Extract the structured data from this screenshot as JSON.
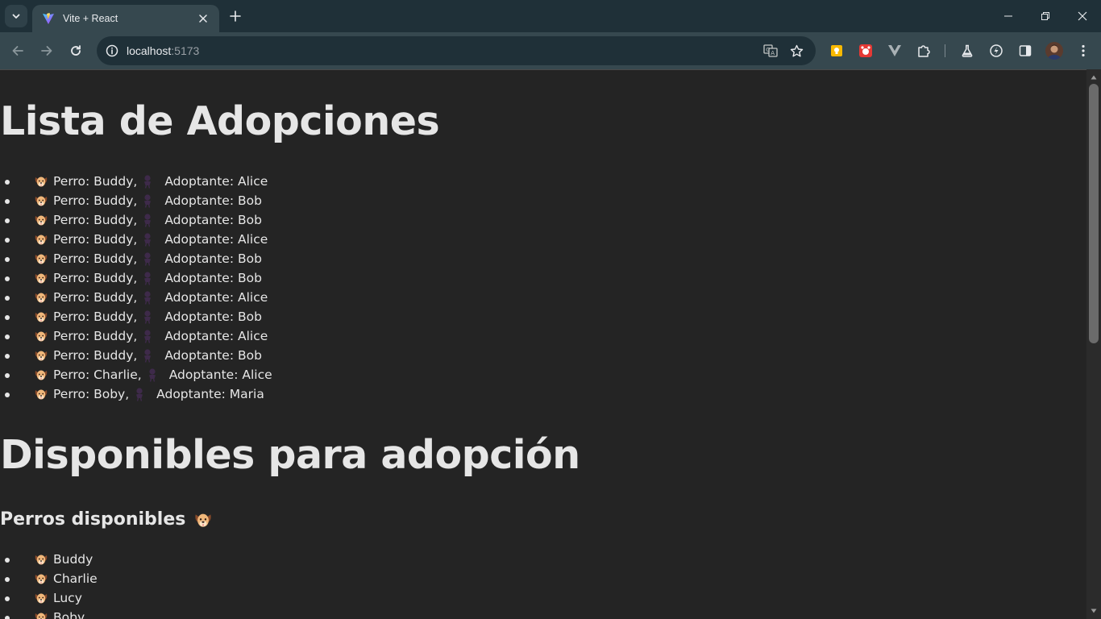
{
  "browser": {
    "tab_title": "Vite + React",
    "url_host": "localhost",
    "url_port": ":5173",
    "icons": {
      "tab_search": "chevron-down-icon",
      "favicon": "vite-logo-icon",
      "tab_close": "close-icon",
      "new_tab": "plus-icon",
      "back": "arrow-left-icon",
      "forward": "arrow-right-icon",
      "reload": "reload-icon",
      "site_info": "info-icon",
      "translate": "translate-icon",
      "bookmark": "star-icon",
      "extensions": "puzzle-icon",
      "labs": "flask-icon",
      "performance": "speedometer-icon",
      "side_panel": "side-panel-icon",
      "menu": "kebab-menu-icon",
      "minimize": "minimize-icon",
      "restore": "restore-icon",
      "close_window": "close-icon"
    },
    "accent_colors": {
      "tabstrip": "#1f3038",
      "toolbar": "#36484f",
      "page_background": "#242424"
    }
  },
  "page": {
    "adoptions_title": "Lista de Adopciones",
    "adoptions": [
      {
        "dog": "Perro: Buddy,",
        "adopter": "Adoptante: Alice"
      },
      {
        "dog": "Perro: Buddy,",
        "adopter": "Adoptante: Bob"
      },
      {
        "dog": "Perro: Buddy,",
        "adopter": "Adoptante: Bob"
      },
      {
        "dog": "Perro: Buddy,",
        "adopter": "Adoptante: Alice"
      },
      {
        "dog": "Perro: Buddy,",
        "adopter": "Adoptante: Bob"
      },
      {
        "dog": "Perro: Buddy,",
        "adopter": "Adoptante: Bob"
      },
      {
        "dog": "Perro: Buddy,",
        "adopter": "Adoptante: Alice"
      },
      {
        "dog": "Perro: Buddy,",
        "adopter": "Adoptante: Bob"
      },
      {
        "dog": "Perro: Buddy,",
        "adopter": "Adoptante: Alice"
      },
      {
        "dog": "Perro: Buddy,",
        "adopter": "Adoptante: Bob"
      },
      {
        "dog": "Perro: Charlie,",
        "adopter": "Adoptante: Alice"
      },
      {
        "dog": "Perro: Boby,",
        "adopter": "Adoptante: Maria"
      }
    ],
    "available_title": "Disponibles para adopción",
    "dogs_subtitle": "Perros disponibles",
    "dogs": [
      "Buddy",
      "Charlie",
      "Lucy",
      "Boby"
    ]
  }
}
